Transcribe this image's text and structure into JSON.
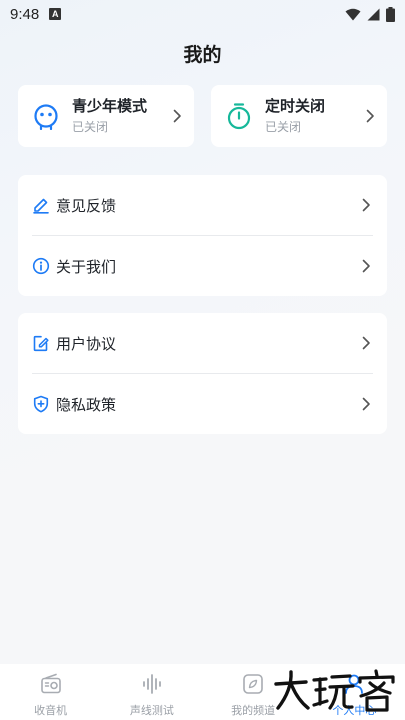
{
  "status_bar": {
    "time": "9:48",
    "notification_glyph": "A"
  },
  "header": {
    "title": "我的"
  },
  "mode_cards": [
    {
      "title": "青少年模式",
      "status": "已关闭",
      "icon": "robot-face-icon",
      "color": "#1e7bf5"
    },
    {
      "title": "定时关闭",
      "status": "已关闭",
      "icon": "stopwatch-icon",
      "color": "#16b89a"
    }
  ],
  "list_group_1": [
    {
      "label": "意见反馈",
      "icon": "edit-pencil-icon"
    },
    {
      "label": "关于我们",
      "icon": "info-circle-icon"
    }
  ],
  "list_group_2": [
    {
      "label": "用户协议",
      "icon": "document-edit-icon"
    },
    {
      "label": "隐私政策",
      "icon": "shield-plus-icon"
    }
  ],
  "bottom_nav": [
    {
      "label": "收音机",
      "icon": "radio-icon",
      "active": false
    },
    {
      "label": "声线测试",
      "icon": "sound-wave-icon",
      "active": false
    },
    {
      "label": "我的频道",
      "icon": "channel-leaf-icon",
      "active": false
    },
    {
      "label": "个人中心",
      "icon": "person-icon",
      "active": true
    }
  ],
  "watermark": {
    "text": "大玩客"
  },
  "colors": {
    "accent": "#1e7bf5",
    "timer": "#16b89a",
    "muted": "#9aa0a8"
  }
}
